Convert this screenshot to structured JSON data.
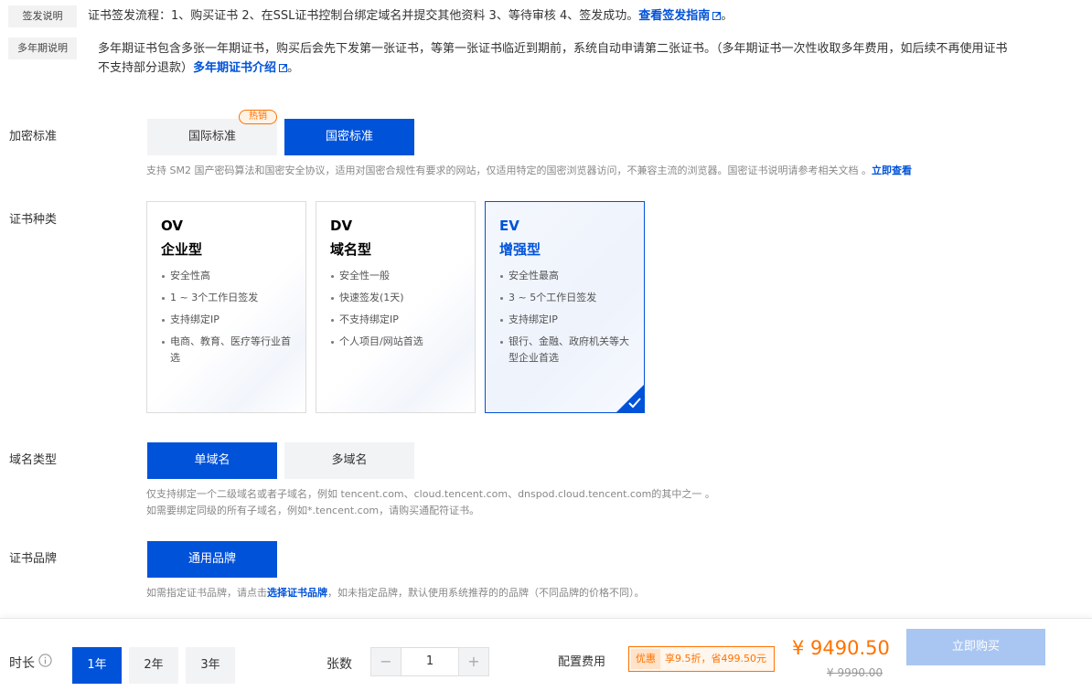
{
  "issuance": {
    "tag": "签发说明",
    "text": "证书签发流程：1、购买证书 2、在SSL证书控制台绑定域名并提交其他资料 3、等待审核 4、签发成功。",
    "link": "查看签发指南",
    "tail": "。"
  },
  "multiyear": {
    "tag": "多年期说明",
    "line1": "多年期证书包含多张一年期证书，购买后会先下发第一张证书，等第一张证书临近到期前，系统自动申请第二张证书。（多年期证书一次性收取多年费用，如后续不再使用证书",
    "line2": "不支持部分退款）",
    "link": "多年期证书介绍",
    "tail": "。"
  },
  "encryption": {
    "label": "加密标准",
    "options": [
      "国际标准",
      "国密标准"
    ],
    "selected": "国密标准",
    "hot_badge": "热销",
    "hint": "支持 SM2 国产密码算法和国密安全协议，适用对国密合规性有要求的网站，仅适用特定的国密浏览器访问，不兼容主流的浏览器。国密证书说明请参考相关文档 。",
    "hint_link": "立即查看"
  },
  "cert_type": {
    "label": "证书种类",
    "cards": [
      {
        "code": "OV",
        "name": "企业型",
        "features": [
          "安全性高",
          "1 ~ 3个工作日签发",
          "支持绑定IP",
          "电商、教育、医疗等行业首选"
        ]
      },
      {
        "code": "DV",
        "name": "域名型",
        "features": [
          "安全性一般",
          "快速签发(1天)",
          "不支持绑定IP",
          "个人项目/网站首选"
        ]
      },
      {
        "code": "EV",
        "name": "增强型",
        "features": [
          "安全性最高",
          "3 ~ 5个工作日签发",
          "支持绑定IP",
          "银行、金融、政府机关等大型企业首选"
        ]
      }
    ],
    "selected": "EV"
  },
  "domain_type": {
    "label": "域名类型",
    "options": [
      "单域名",
      "多域名"
    ],
    "selected": "单域名",
    "hint1": "仅支持绑定一个二级域名或者子域名，例如 tencent.com、cloud.tencent.com、dnspod.cloud.tencent.com的其中之一 。",
    "hint2": "如需要绑定同级的所有子域名，例如*.tencent.com，请购买通配符证书。"
  },
  "brand": {
    "label": "证书品牌",
    "option": "通用品牌",
    "hint_pre": "如需指定证书品牌，请点击",
    "hint_link": "选择证书品牌",
    "hint_post": "，如未指定品牌，默认使用系统推荐的的品牌（不同品牌的价格不同）。"
  },
  "footer": {
    "duration_label": "时长",
    "durations": [
      "1年",
      "2年",
      "3年"
    ],
    "selected_duration": "1年",
    "quantity_label": "张数",
    "quantity": "1",
    "minus": "−",
    "plus": "+",
    "fee_label": "配置费用",
    "discount_tag": "优惠",
    "discount_text": "享9.5折，省499.50元",
    "price": "¥ 9490.50",
    "original_price": "¥ 9990.00",
    "buy_label": "立即购买"
  },
  "colors": {
    "primary": "#0052d9",
    "accent_orange": "#ff7200",
    "buy_disabled": "#a9c6f2"
  }
}
